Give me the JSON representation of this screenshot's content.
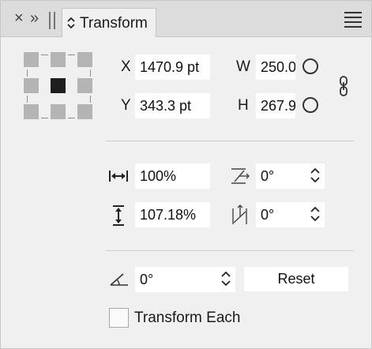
{
  "tabbar": {
    "close_glyph": "×",
    "collapse_glyph": "»",
    "tab_label": "Transform"
  },
  "position": {
    "x_label": "X",
    "x_value": "1470.9 pt",
    "y_label": "Y",
    "y_value": "343.3 pt"
  },
  "size": {
    "w_label": "W",
    "w_value": "250.0",
    "h_label": "H",
    "h_value": "267.9"
  },
  "scale": {
    "horizontal_value": "100%",
    "vertical_value": "107.18%"
  },
  "shear": {
    "horizontal_value": "0°",
    "vertical_value": "0°"
  },
  "rotation": {
    "value": "0°"
  },
  "actions": {
    "reset_label": "Reset",
    "transform_each_label": "Transform Each"
  },
  "colors": {
    "panel_bg": "#f0f0f0",
    "tabbar_bg": "#dcdcdc",
    "field_bg": "#ffffff",
    "anchor_selected": "#1e1e1e",
    "anchor_default": "#b4b4b4"
  },
  "icons": [
    "close-icon",
    "collapse-icon",
    "drag-handle-icon",
    "chevron-updown-icon",
    "menu-icon",
    "link-chain-icon",
    "scale-horizontal-icon",
    "scale-vertical-icon",
    "shear-horizontal-icon",
    "shear-vertical-icon",
    "rotate-angle-icon",
    "spinner-icon"
  ]
}
